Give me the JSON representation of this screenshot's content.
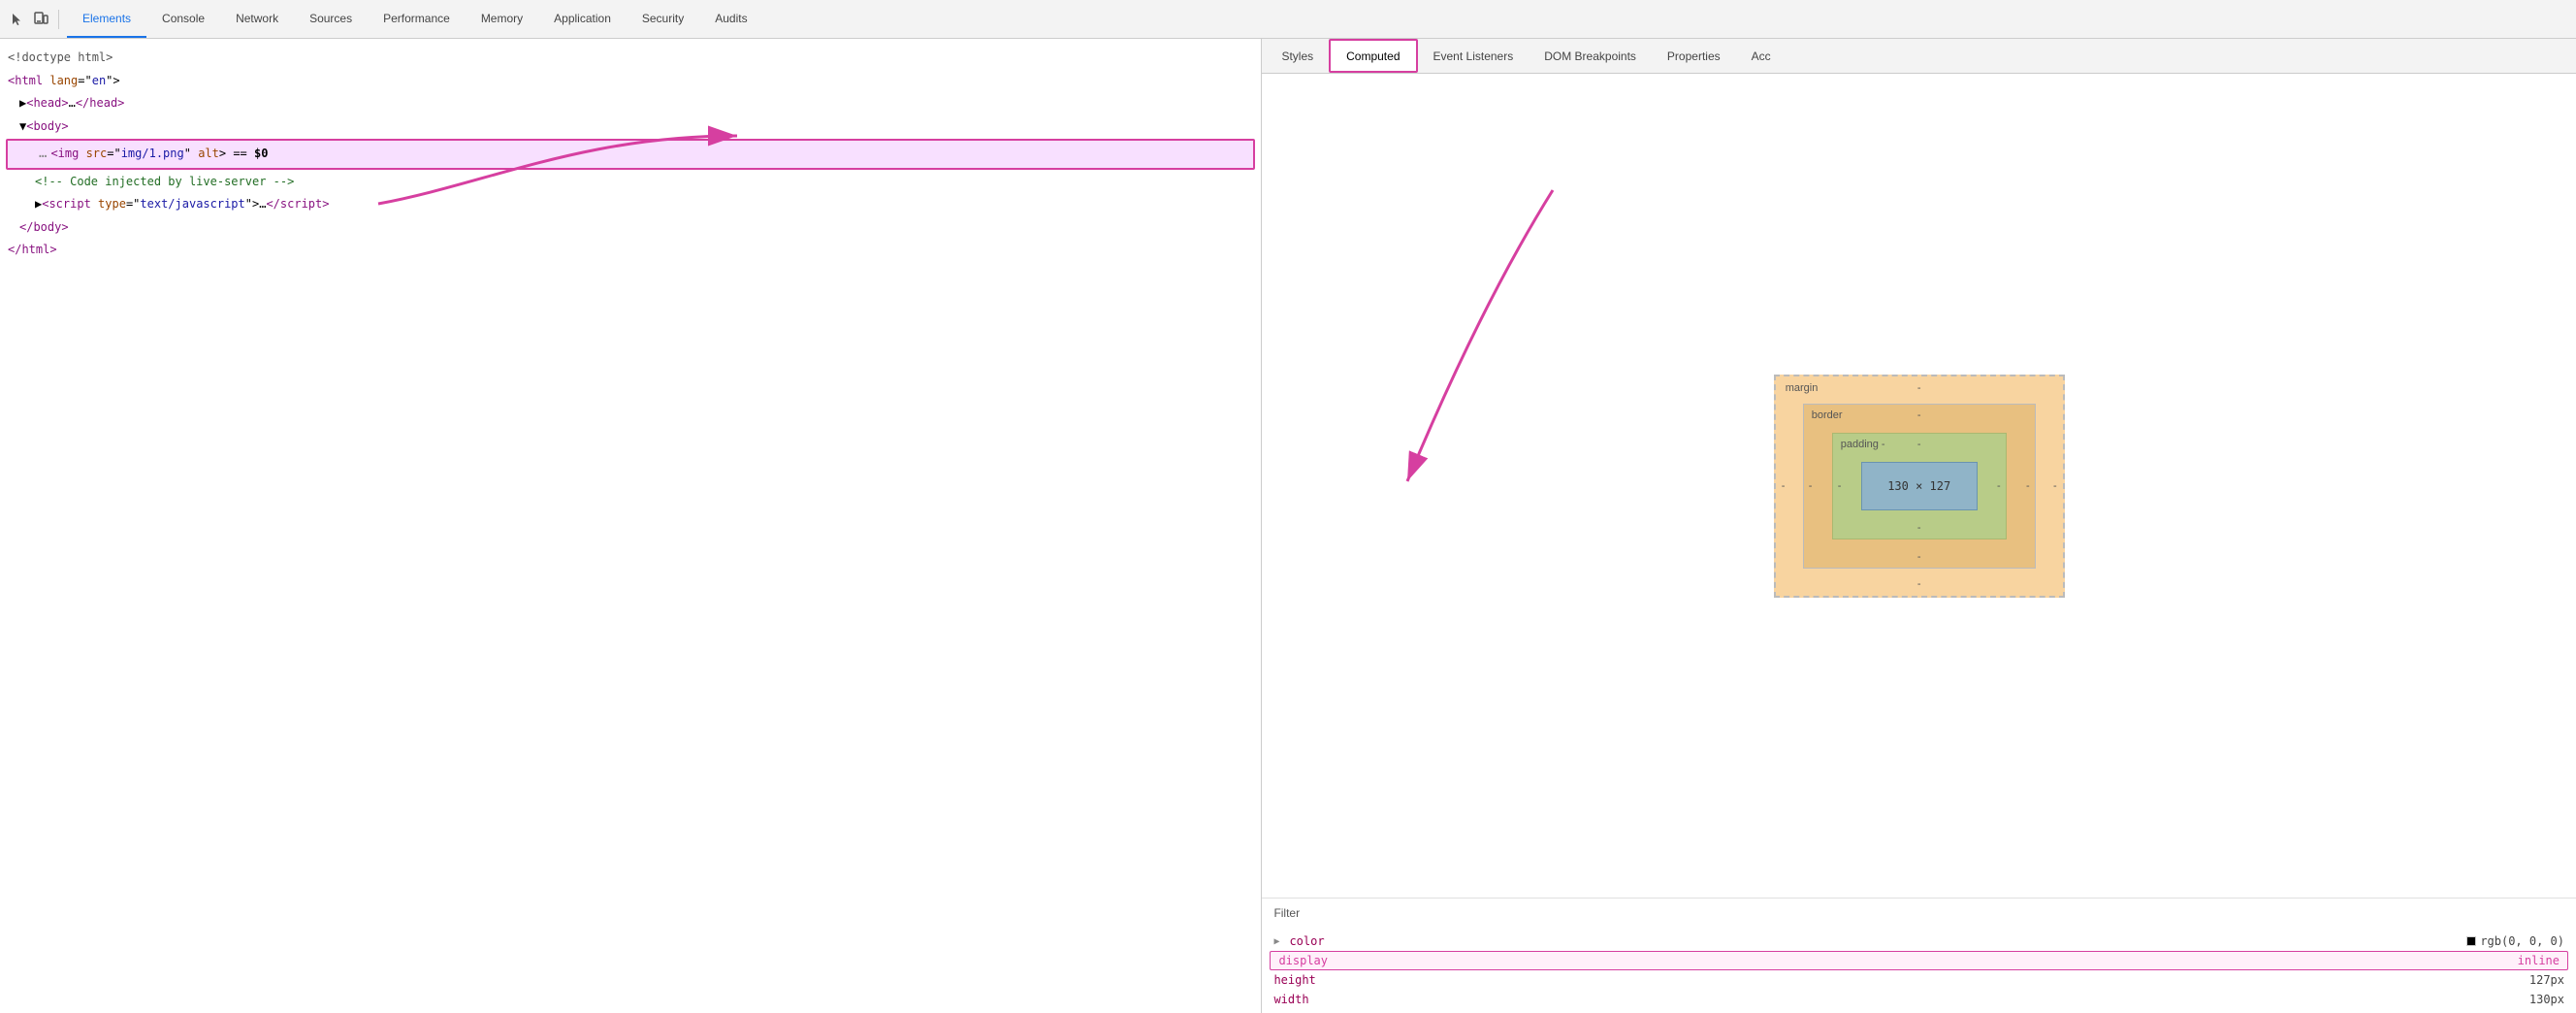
{
  "toolbar": {
    "icons": [
      {
        "name": "cursor-icon",
        "symbol": "↖",
        "label": "Cursor"
      },
      {
        "name": "device-icon",
        "symbol": "⬜",
        "label": "Device"
      }
    ]
  },
  "main_tabs": [
    {
      "id": "elements",
      "label": "Elements",
      "active": true
    },
    {
      "id": "console",
      "label": "Console",
      "active": false
    },
    {
      "id": "network",
      "label": "Network",
      "active": false
    },
    {
      "id": "sources",
      "label": "Sources",
      "active": false
    },
    {
      "id": "performance",
      "label": "Performance",
      "active": false
    },
    {
      "id": "memory",
      "label": "Memory",
      "active": false
    },
    {
      "id": "application",
      "label": "Application",
      "active": false
    },
    {
      "id": "security",
      "label": "Security",
      "active": false
    },
    {
      "id": "audits",
      "label": "Audits",
      "active": false
    }
  ],
  "sub_tabs": [
    {
      "id": "styles",
      "label": "Styles",
      "active": false
    },
    {
      "id": "computed",
      "label": "Computed",
      "active": true
    },
    {
      "id": "event-listeners",
      "label": "Event Listeners",
      "active": false
    },
    {
      "id": "dom-breakpoints",
      "label": "DOM Breakpoints",
      "active": false
    },
    {
      "id": "properties",
      "label": "Properties",
      "active": false
    },
    {
      "id": "accessibility",
      "label": "Acc",
      "active": false
    }
  ],
  "elements_panel": {
    "lines": [
      {
        "id": "doctype",
        "indent": 0,
        "content": "<!doctype html>",
        "type": "doctype"
      },
      {
        "id": "html-open",
        "indent": 0,
        "content_html": "&lt;html lang=\"en\"&gt;",
        "type": "tag"
      },
      {
        "id": "head",
        "indent": 1,
        "content_html": "&#9658;&lt;head&gt;…&lt;/head&gt;",
        "type": "tag"
      },
      {
        "id": "body-open",
        "indent": 1,
        "content_html": "&#9660;&lt;body&gt;",
        "type": "tag"
      },
      {
        "id": "img",
        "indent": 2,
        "content_html": "&lt;img src=<span class='attr-value'>\"img/1.png\"</span> alt&gt; == <span class='selected-indicator'>$0</span>",
        "type": "tag",
        "selected": true,
        "highlighted": true
      },
      {
        "id": "comment",
        "indent": 2,
        "content": "<!-- Code injected by live-server -->",
        "type": "comment"
      },
      {
        "id": "script",
        "indent": 2,
        "content_html": "&#9658;&lt;script type=<span class='attr-value'>\"text/javascript\"</span>&gt;…&lt;/script&gt;",
        "type": "tag"
      },
      {
        "id": "body-close",
        "indent": 1,
        "content": "</body>",
        "type": "tag"
      },
      {
        "id": "html-close",
        "indent": 0,
        "content": "</html>",
        "type": "tag"
      }
    ]
  },
  "box_model": {
    "margin_label": "margin",
    "margin_top": "-",
    "margin_right": "-",
    "margin_bottom": "-",
    "margin_left": "-",
    "border_label": "border",
    "border_dash": "-",
    "padding_label": "padding -",
    "padding_top": "-",
    "padding_right": "-",
    "padding_bottom": "-",
    "padding_left": "-",
    "content_size": "130 × 127"
  },
  "filter": {
    "label": "Filter"
  },
  "css_properties": [
    {
      "name": "color",
      "value": "rgb(0, 0, 0)",
      "has_swatch": true,
      "swatch_color": "#000000",
      "has_toggle": true,
      "highlighted": false
    },
    {
      "name": "display",
      "value": "inline",
      "has_swatch": false,
      "has_toggle": false,
      "highlighted": true
    },
    {
      "name": "height",
      "value": "127px",
      "has_swatch": false,
      "has_toggle": false,
      "highlighted": false
    },
    {
      "name": "width",
      "value": "130px",
      "has_swatch": false,
      "has_toggle": false,
      "highlighted": false
    }
  ]
}
